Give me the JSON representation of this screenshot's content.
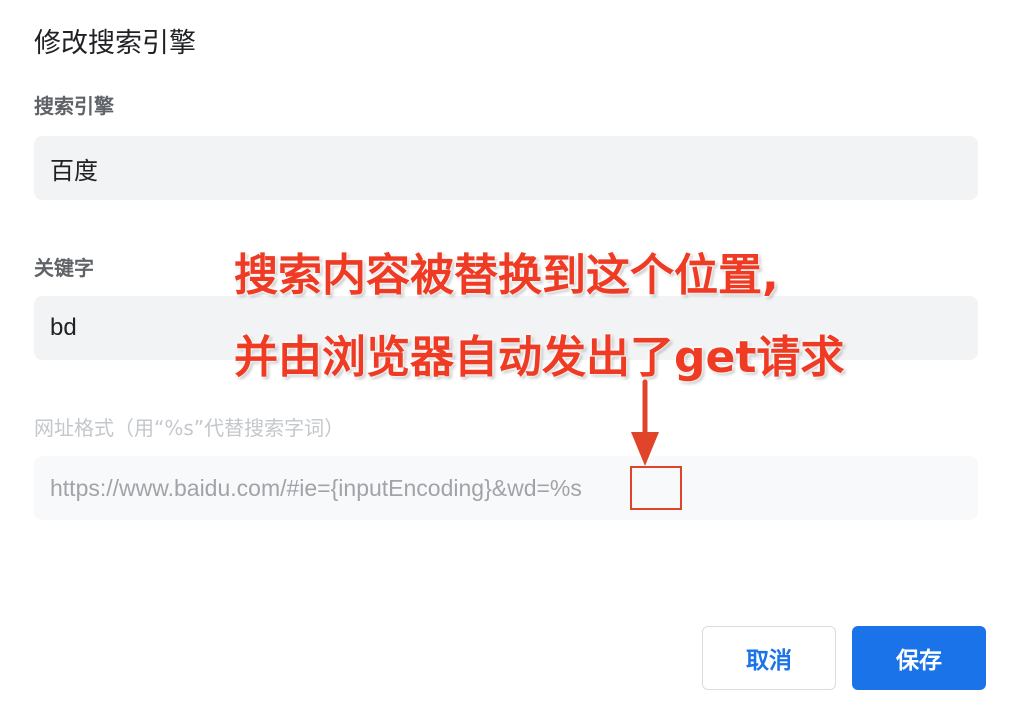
{
  "dialog": {
    "title": "修改搜索引擎"
  },
  "fields": {
    "search_engine": {
      "label": "搜索引擎",
      "value": "百度"
    },
    "keyword": {
      "label": "关键字",
      "value": "bd"
    },
    "url_format": {
      "label": "网址格式（用“%s”代替搜索字词）",
      "value": "https://www.baidu.com/#ie={inputEncoding}&wd=%s"
    }
  },
  "buttons": {
    "cancel_label": "取消",
    "save_label": "保存"
  },
  "annotation": {
    "line1": "搜索内容被替换到这个位置,",
    "line2": "并由浏览器自动发出了get请求"
  },
  "colors": {
    "accent": "#1a73e8",
    "annotation": "#ef3b24",
    "field_bg": "#f1f3f4"
  }
}
